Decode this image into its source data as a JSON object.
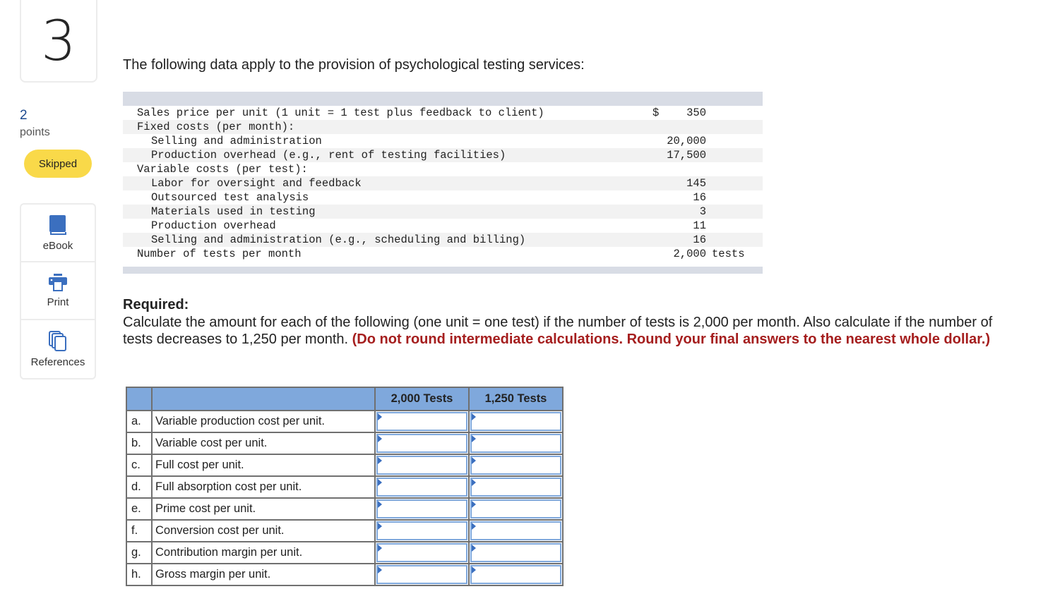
{
  "question": {
    "number": "3",
    "points_value": "2",
    "points_label": "points",
    "status": "Skipped"
  },
  "tools": [
    {
      "label": "eBook",
      "icon": "book-icon"
    },
    {
      "label": "Print",
      "icon": "printer-icon"
    },
    {
      "label": "References",
      "icon": "documents-icon"
    }
  ],
  "intro": "The following data apply to the provision of psychological testing services:",
  "data_rows": [
    {
      "label": "Sales price per unit (1 unit = 1 test plus feedback to client)",
      "indent": false,
      "currency": "$",
      "value": "350",
      "unit": ""
    },
    {
      "label": "Fixed costs (per month):",
      "indent": false,
      "currency": "",
      "value": "",
      "unit": ""
    },
    {
      "label": "Selling and administration",
      "indent": true,
      "currency": "",
      "value": "20,000",
      "unit": ""
    },
    {
      "label": "Production overhead (e.g., rent of testing facilities)",
      "indent": true,
      "currency": "",
      "value": "17,500",
      "unit": ""
    },
    {
      "label": "Variable costs (per test):",
      "indent": false,
      "currency": "",
      "value": "",
      "unit": ""
    },
    {
      "label": "Labor for oversight and feedback",
      "indent": true,
      "currency": "",
      "value": "145",
      "unit": ""
    },
    {
      "label": "Outsourced test analysis",
      "indent": true,
      "currency": "",
      "value": "16",
      "unit": ""
    },
    {
      "label": "Materials used in testing",
      "indent": true,
      "currency": "",
      "value": "3",
      "unit": ""
    },
    {
      "label": "Production overhead",
      "indent": true,
      "currency": "",
      "value": "11",
      "unit": ""
    },
    {
      "label": "Selling and administration (e.g., scheduling and billing)",
      "indent": true,
      "currency": "",
      "value": "16",
      "unit": ""
    },
    {
      "label": "Number of tests per month",
      "indent": false,
      "currency": "",
      "value": "2,000",
      "unit": "tests"
    }
  ],
  "required": {
    "title": "Required:",
    "body": "Calculate the amount for each of the following (one unit = one test) if the number of tests is 2,000 per month. Also calculate if the number of tests decreases to 1,250 per month. ",
    "instruction": "(Do not round intermediate calculations. Round your final answers to the nearest whole dollar.)"
  },
  "answer_table": {
    "headers": [
      "",
      "",
      "2,000 Tests",
      "1,250 Tests"
    ],
    "rows": [
      {
        "letter": "a.",
        "desc": "Variable production cost per unit.",
        "v2000": "",
        "v1250": ""
      },
      {
        "letter": "b.",
        "desc": "Variable cost per unit.",
        "v2000": "",
        "v1250": ""
      },
      {
        "letter": "c.",
        "desc": "Full cost per unit.",
        "v2000": "",
        "v1250": ""
      },
      {
        "letter": "d.",
        "desc": "Full absorption cost per unit.",
        "v2000": "",
        "v1250": ""
      },
      {
        "letter": "e.",
        "desc": "Prime cost per unit.",
        "v2000": "",
        "v1250": ""
      },
      {
        "letter": "f.",
        "desc": "Conversion cost per unit.",
        "v2000": "",
        "v1250": ""
      },
      {
        "letter": "g.",
        "desc": "Contribution margin per unit.",
        "v2000": "",
        "v1250": ""
      },
      {
        "letter": "h.",
        "desc": "Gross margin per unit.",
        "v2000": "",
        "v1250": ""
      }
    ]
  },
  "colors": {
    "accent_blue": "#3b6fbf",
    "header_blue": "#7fa8dc",
    "badge_yellow": "#f9d949",
    "instruction_red": "#a51e1e",
    "points_blue": "#1d4a8f"
  }
}
